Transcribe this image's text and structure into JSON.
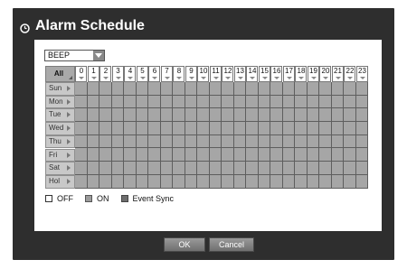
{
  "dialog": {
    "title": "Alarm Schedule",
    "icon": "clock-icon"
  },
  "alarm_select": {
    "value": "BEEP"
  },
  "grid": {
    "all_label": "All",
    "hours": [
      "0",
      "1",
      "2",
      "3",
      "4",
      "5",
      "6",
      "7",
      "8",
      "9",
      "10",
      "11",
      "12",
      "13",
      "14",
      "15",
      "16",
      "17",
      "18",
      "19",
      "20",
      "21",
      "22",
      "23"
    ],
    "days": [
      "Sun",
      "Mon",
      "Tue",
      "Wed",
      "Thu",
      "Fri",
      "Sat",
      "Hol"
    ],
    "cell_state": "ON"
  },
  "legend": {
    "off": "OFF",
    "on": "ON",
    "event_sync": "Event Sync"
  },
  "buttons": {
    "ok": "OK",
    "cancel": "Cancel"
  },
  "colors": {
    "frame": "#2e2e2e",
    "cell_on": "#a6a6a6",
    "event_sync": "#6e6e6e"
  }
}
